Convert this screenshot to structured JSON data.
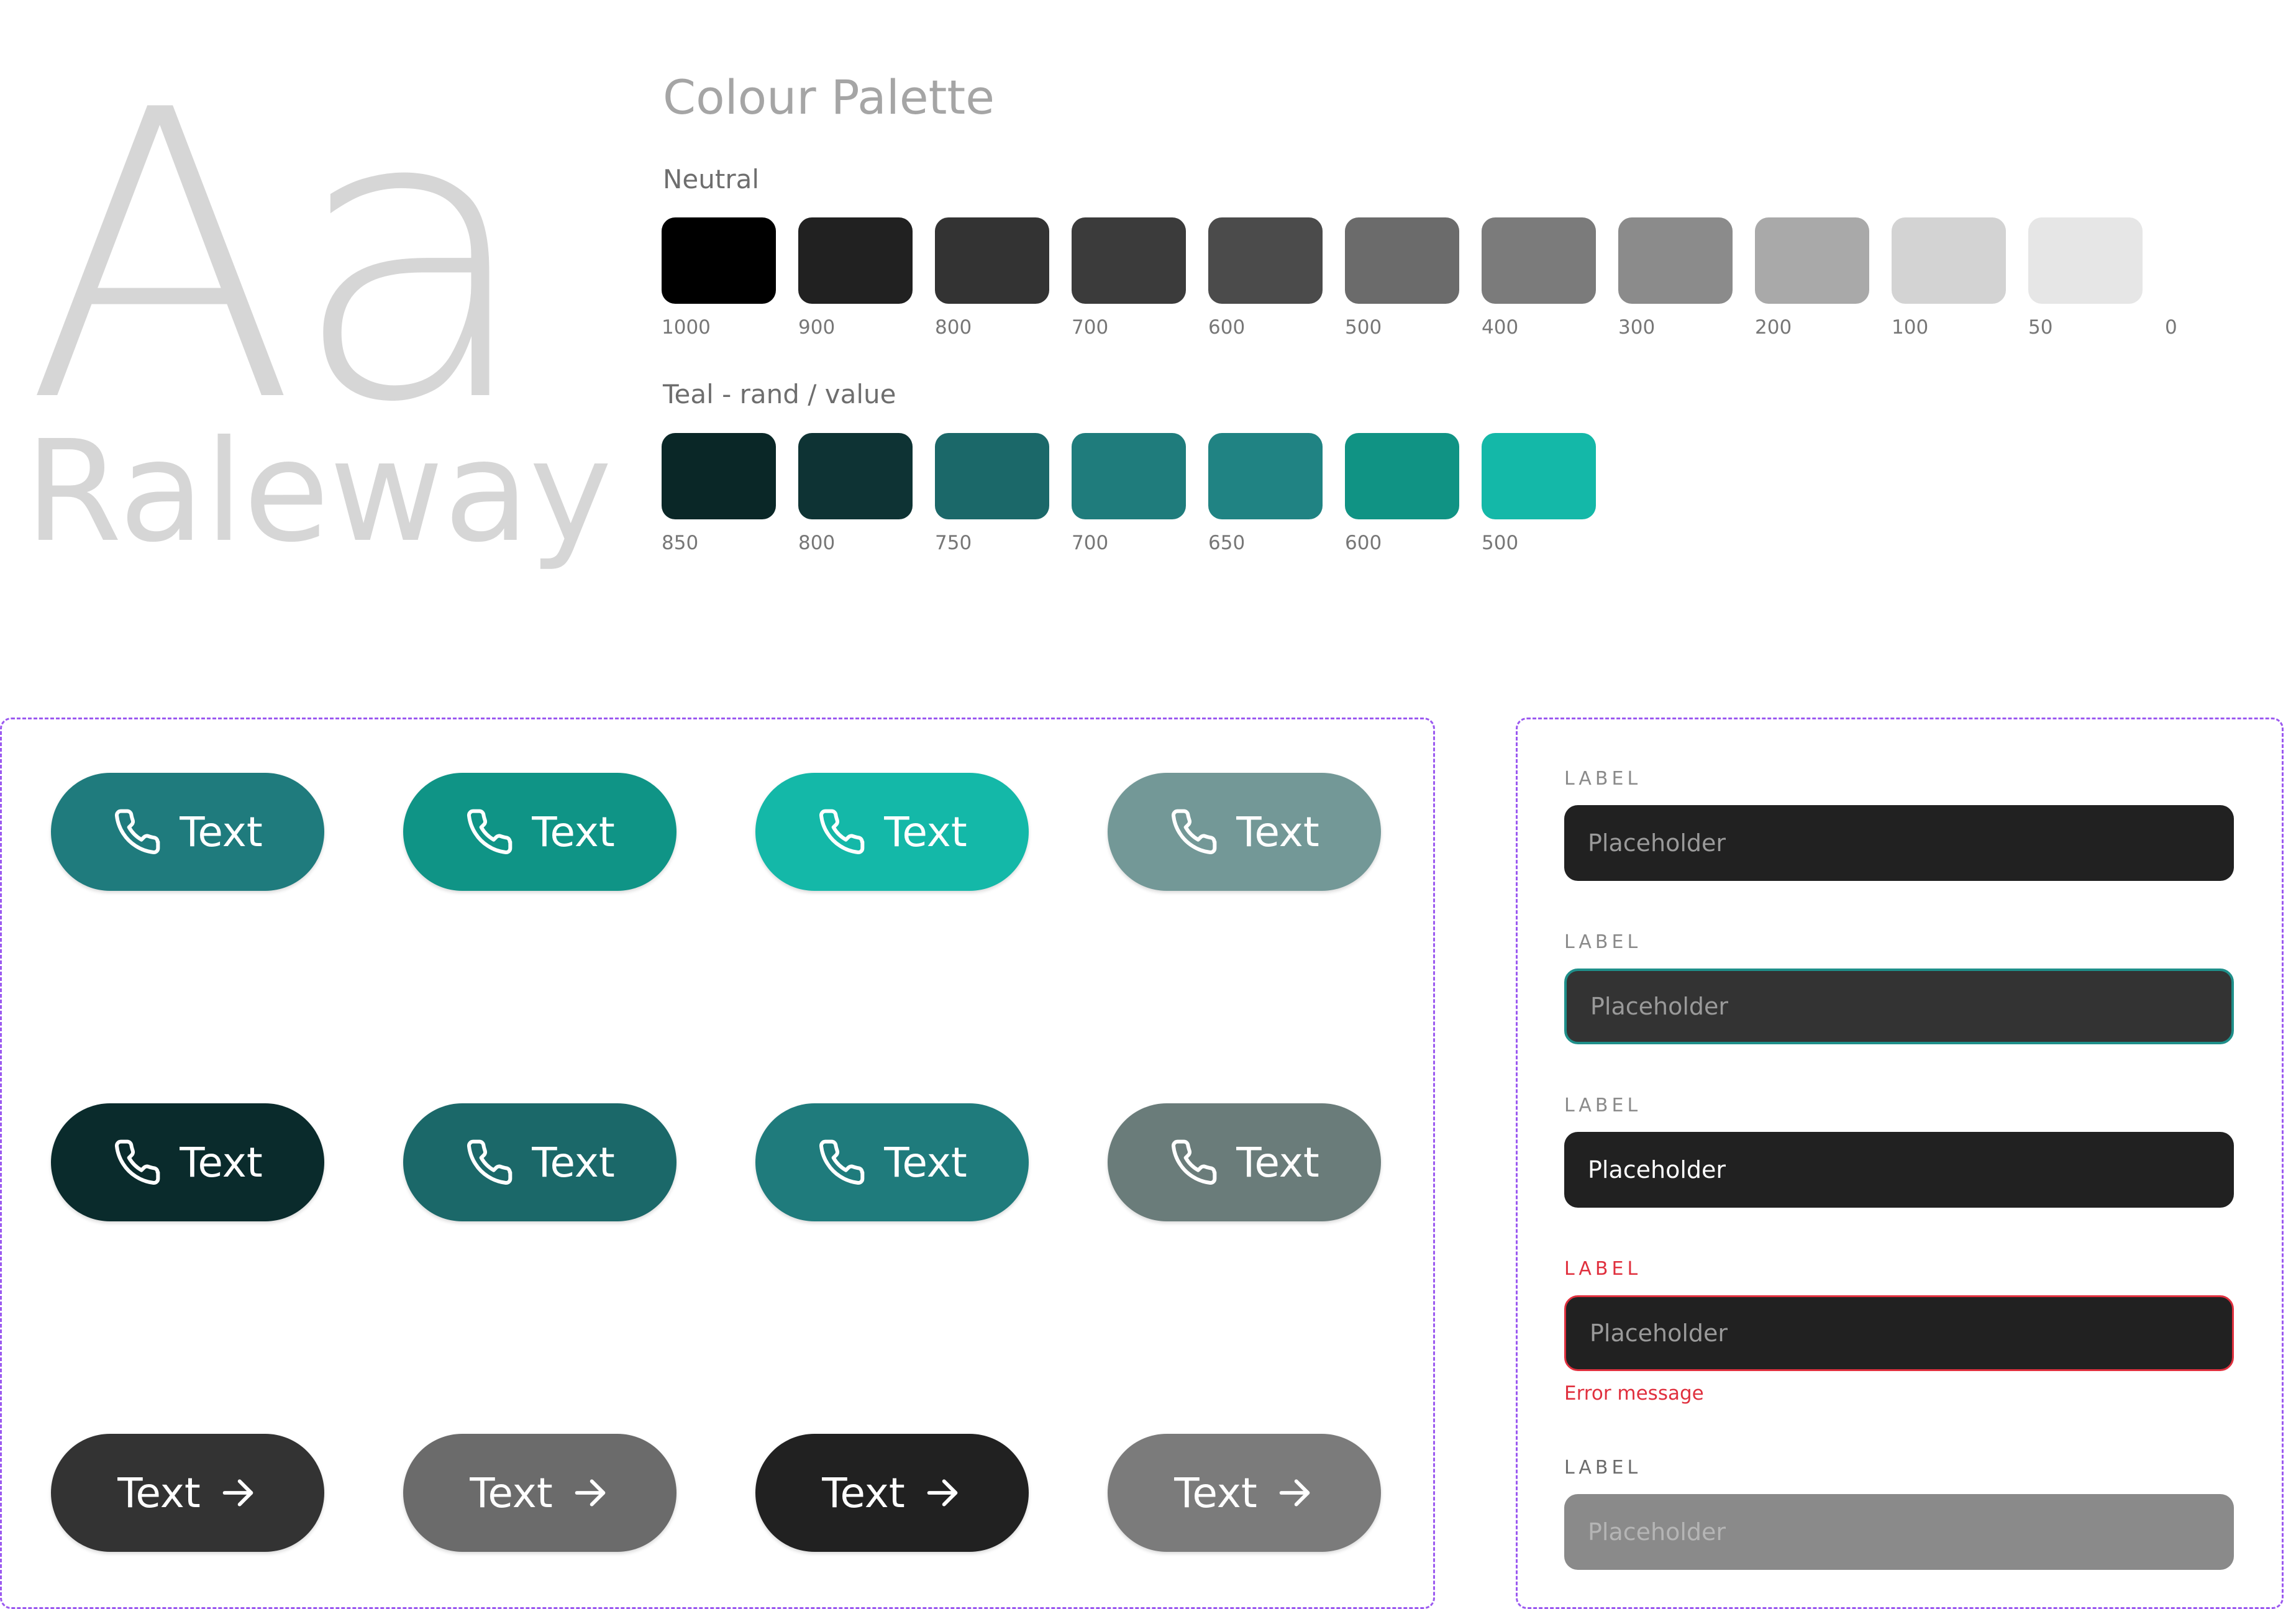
{
  "typography": {
    "sample": "Aa",
    "font_name": "Raleway"
  },
  "palette": {
    "title": "Colour Palette",
    "neutral": {
      "title": "Neutral",
      "swatches": [
        {
          "code": "1000",
          "color": "#000000"
        },
        {
          "code": "900",
          "color": "#212121"
        },
        {
          "code": "800",
          "color": "#333333"
        },
        {
          "code": "700",
          "color": "#3b3b3b"
        },
        {
          "code": "600",
          "color": "#4b4b4b"
        },
        {
          "code": "500",
          "color": "#6b6b6b"
        },
        {
          "code": "400",
          "color": "#7b7b7b"
        },
        {
          "code": "300",
          "color": "#8b8b8b"
        },
        {
          "code": "200",
          "color": "#a9a9a9"
        },
        {
          "code": "100",
          "color": "#d3d3d3"
        },
        {
          "code": "50",
          "color": "#e6e6e6"
        },
        {
          "code": "0",
          "color": "#ffffff"
        }
      ]
    },
    "teal": {
      "title": "Teal - rand / value",
      "swatches": [
        {
          "code": "850",
          "color": "#0a2727"
        },
        {
          "code": "800",
          "color": "#0e3334"
        },
        {
          "code": "750",
          "color": "#1b6869"
        },
        {
          "code": "700",
          "color": "#1f7c7c"
        },
        {
          "code": "650",
          "color": "#208383"
        },
        {
          "code": "600",
          "color": "#109384"
        },
        {
          "code": "500",
          "color": "#14b8a8"
        }
      ]
    }
  },
  "buttons": [
    {
      "label": "Text",
      "icon": "phone-icon",
      "color": "#1f7b7d"
    },
    {
      "label": "Text",
      "icon": "phone-icon",
      "color": "#0f9486"
    },
    {
      "label": "Text",
      "icon": "phone-icon",
      "color": "#14b8a8"
    },
    {
      "label": "Text",
      "icon": "phone-icon",
      "color": "#739897"
    },
    {
      "label": "Text",
      "icon": "phone-icon",
      "color": "#0a2b2c"
    },
    {
      "label": "Text",
      "icon": "phone-icon",
      "color": "#1b6869"
    },
    {
      "label": "Text",
      "icon": "phone-icon",
      "color": "#1f7b7c"
    },
    {
      "label": "Text",
      "icon": "phone-icon",
      "color": "#6a7c7a"
    },
    {
      "label": "Text",
      "icon": "arrow-right-icon",
      "color": "#333333"
    },
    {
      "label": "Text",
      "icon": "arrow-right-icon",
      "color": "#6b6b6b"
    },
    {
      "label": "Text",
      "icon": "arrow-right-icon",
      "color": "#212121"
    },
    {
      "label": "Text",
      "icon": "arrow-right-icon",
      "color": "#7b7b7b"
    }
  ],
  "fields": [
    {
      "label": "LABEL",
      "placeholder": "Placeholder",
      "state": "default"
    },
    {
      "label": "LABEL",
      "placeholder": "Placeholder",
      "state": "focused"
    },
    {
      "label": "LABEL",
      "value": "Placeholder",
      "state": "filled"
    },
    {
      "label": "LABEL",
      "placeholder": "Placeholder",
      "state": "error",
      "error": "Error message"
    },
    {
      "label": "LABEL",
      "placeholder": "Placeholder",
      "state": "disabled"
    }
  ],
  "colors": {
    "frame_border": "#9b59f0",
    "error": "#e0303e",
    "focus": "#1f8f8a"
  }
}
